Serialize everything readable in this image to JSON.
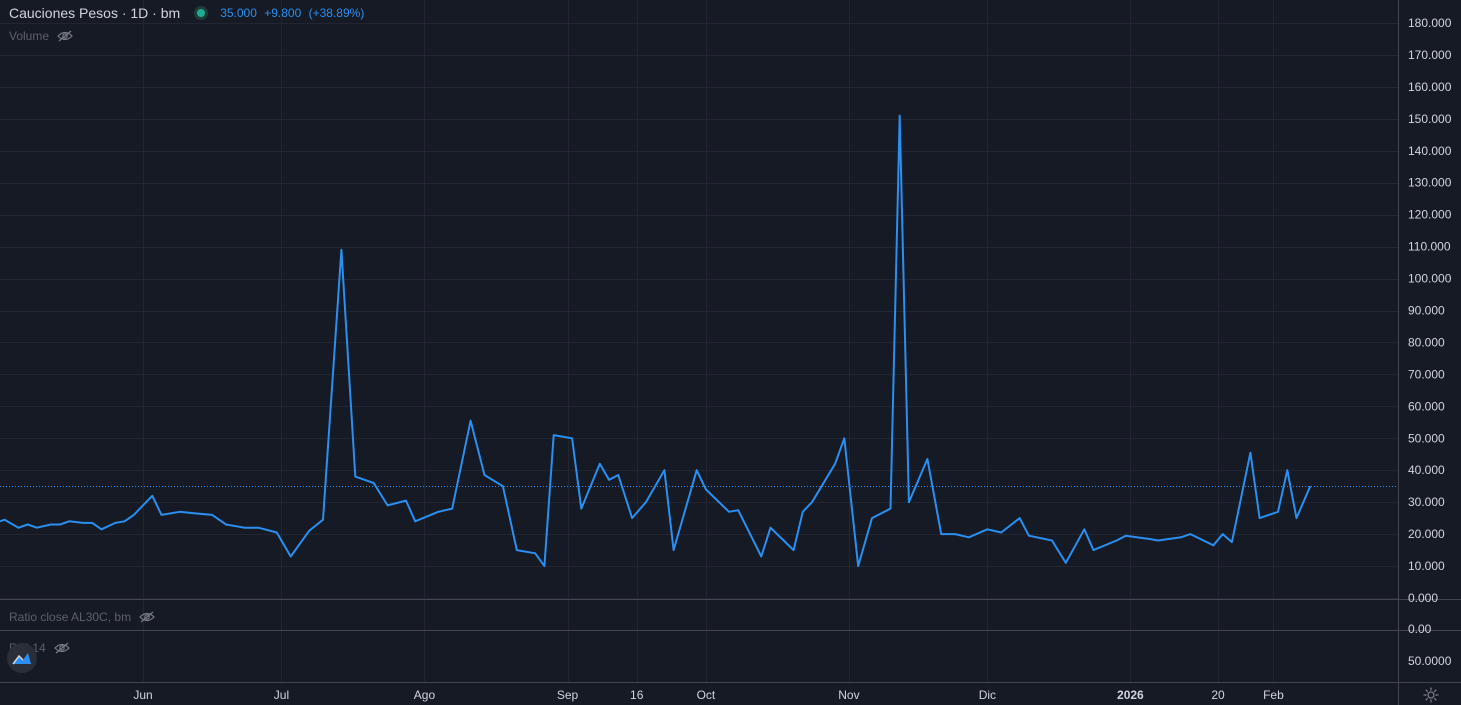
{
  "legend": {
    "symbol_title": "Cauciones Pesos · 1D · bm",
    "last_value": "35.000",
    "change": "+9.800",
    "change_pct": "(+38.89%)",
    "status_color": "#22ab94",
    "value_color": "#2a8ff0"
  },
  "panes": {
    "volume_label": "Volume",
    "ratio_label": "Ratio close AL30C, bm",
    "rsi_label": "RSI 14",
    "ratio_axis_label": "0.00",
    "rsi_axis_label": "50.0000"
  },
  "icons": {
    "hide": "eye-off-icon",
    "settings": "gear-icon",
    "logo": "tradingview-logo-icon"
  },
  "chart_data": {
    "type": "line",
    "title": "Cauciones Pesos · 1D · bm",
    "ylim": [
      0,
      180
    ],
    "yticks": [
      "0.000",
      "10.000",
      "20.000",
      "30.000",
      "40.000",
      "50.000",
      "60.000",
      "70.000",
      "80.000",
      "90.000",
      "100.000",
      "110.000",
      "120.000",
      "130.000",
      "140.000",
      "150.000",
      "160.000",
      "170.000",
      "180.000"
    ],
    "xlim": [
      "2025-05-01",
      "2026-02-28"
    ],
    "xticks": [
      {
        "date": "2025-06-01",
        "label": "Jun"
      },
      {
        "date": "2025-07-01",
        "label": "Jul"
      },
      {
        "date": "2025-08-01",
        "label": "Ago"
      },
      {
        "date": "2025-09-01",
        "label": "Sep"
      },
      {
        "date": "2025-09-16",
        "label": "16"
      },
      {
        "date": "2025-10-01",
        "label": "Oct"
      },
      {
        "date": "2025-11-01",
        "label": "Nov"
      },
      {
        "date": "2025-12-01",
        "label": "Dic"
      },
      {
        "date": "2026-01-01",
        "label": "2026",
        "bold": true
      },
      {
        "date": "2026-01-20",
        "label": "20"
      },
      {
        "date": "2026-02-01",
        "label": "Feb"
      }
    ],
    "last_price_line": 35,
    "grid": true,
    "line_color": "#2a8ff0",
    "series": [
      {
        "points": [
          [
            "2025-05-01",
            24.0
          ],
          [
            "2025-05-02",
            24.5
          ],
          [
            "2025-05-05",
            22.0
          ],
          [
            "2025-05-07",
            23.0
          ],
          [
            "2025-05-09",
            22.0
          ],
          [
            "2025-05-12",
            23.0
          ],
          [
            "2025-05-14",
            23.0
          ],
          [
            "2025-05-16",
            24.0
          ],
          [
            "2025-05-19",
            23.5
          ],
          [
            "2025-05-21",
            23.5
          ],
          [
            "2025-05-23",
            21.5
          ],
          [
            "2025-05-26",
            23.5
          ],
          [
            "2025-05-28",
            24.0
          ],
          [
            "2025-05-30",
            26.0
          ],
          [
            "2025-06-03",
            32.0
          ],
          [
            "2025-06-05",
            26.0
          ],
          [
            "2025-06-09",
            27.0
          ],
          [
            "2025-06-12",
            26.5
          ],
          [
            "2025-06-16",
            26.0
          ],
          [
            "2025-06-19",
            23.0
          ],
          [
            "2025-06-23",
            22.0
          ],
          [
            "2025-06-26",
            22.0
          ],
          [
            "2025-06-30",
            20.5
          ],
          [
            "2025-07-03",
            13.0
          ],
          [
            "2025-07-07",
            21.0
          ],
          [
            "2025-07-10",
            24.5
          ],
          [
            "2025-07-14",
            109.0
          ],
          [
            "2025-07-17",
            38.0
          ],
          [
            "2025-07-21",
            36.0
          ],
          [
            "2025-07-24",
            29.0
          ],
          [
            "2025-07-28",
            30.5
          ],
          [
            "2025-07-30",
            24.0
          ],
          [
            "2025-08-04",
            27.0
          ],
          [
            "2025-08-07",
            28.0
          ],
          [
            "2025-08-11",
            55.5
          ],
          [
            "2025-08-14",
            38.5
          ],
          [
            "2025-08-18",
            35.0
          ],
          [
            "2025-08-21",
            15.0
          ],
          [
            "2025-08-25",
            14.0
          ],
          [
            "2025-08-27",
            10.0
          ],
          [
            "2025-08-29",
            51.0
          ],
          [
            "2025-09-02",
            50.0
          ],
          [
            "2025-09-04",
            28.0
          ],
          [
            "2025-09-08",
            42.0
          ],
          [
            "2025-09-10",
            37.0
          ],
          [
            "2025-09-12",
            38.5
          ],
          [
            "2025-09-15",
            25.0
          ],
          [
            "2025-09-18",
            30.0
          ],
          [
            "2025-09-22",
            40.0
          ],
          [
            "2025-09-24",
            15.0
          ],
          [
            "2025-09-29",
            40.0
          ],
          [
            "2025-10-01",
            34.0
          ],
          [
            "2025-10-06",
            27.0
          ],
          [
            "2025-10-08",
            27.5
          ],
          [
            "2025-10-13",
            13.0
          ],
          [
            "2025-10-15",
            22.0
          ],
          [
            "2025-10-20",
            15.0
          ],
          [
            "2025-10-22",
            27.0
          ],
          [
            "2025-10-24",
            30.0
          ],
          [
            "2025-10-29",
            42.0
          ],
          [
            "2025-10-31",
            50.0
          ],
          [
            "2025-11-03",
            10.0
          ],
          [
            "2025-11-06",
            25.0
          ],
          [
            "2025-11-10",
            28.0
          ],
          [
            "2025-11-12",
            151.0
          ],
          [
            "2025-11-14",
            30.0
          ],
          [
            "2025-11-18",
            43.5
          ],
          [
            "2025-11-21",
            20.0
          ],
          [
            "2025-11-24",
            20.0
          ],
          [
            "2025-11-27",
            19.0
          ],
          [
            "2025-12-01",
            21.5
          ],
          [
            "2025-12-04",
            20.5
          ],
          [
            "2025-12-08",
            25.0
          ],
          [
            "2025-12-10",
            19.5
          ],
          [
            "2025-12-15",
            18.0
          ],
          [
            "2025-12-18",
            11.0
          ],
          [
            "2025-12-22",
            21.5
          ],
          [
            "2025-12-24",
            15.0
          ],
          [
            "2025-12-29",
            18.0
          ],
          [
            "2025-12-31",
            19.5
          ],
          [
            "2026-01-05",
            18.5
          ],
          [
            "2026-01-07",
            18.0
          ],
          [
            "2026-01-12",
            19.0
          ],
          [
            "2026-01-14",
            20.0
          ],
          [
            "2026-01-19",
            16.5
          ],
          [
            "2026-01-21",
            20.0
          ],
          [
            "2026-01-23",
            17.5
          ],
          [
            "2026-01-27",
            45.5
          ],
          [
            "2026-01-29",
            25.0
          ],
          [
            "2026-02-02",
            27.0
          ],
          [
            "2026-02-04",
            40.0
          ],
          [
            "2026-02-06",
            25.0
          ],
          [
            "2026-02-09",
            35.0
          ]
        ]
      }
    ]
  }
}
